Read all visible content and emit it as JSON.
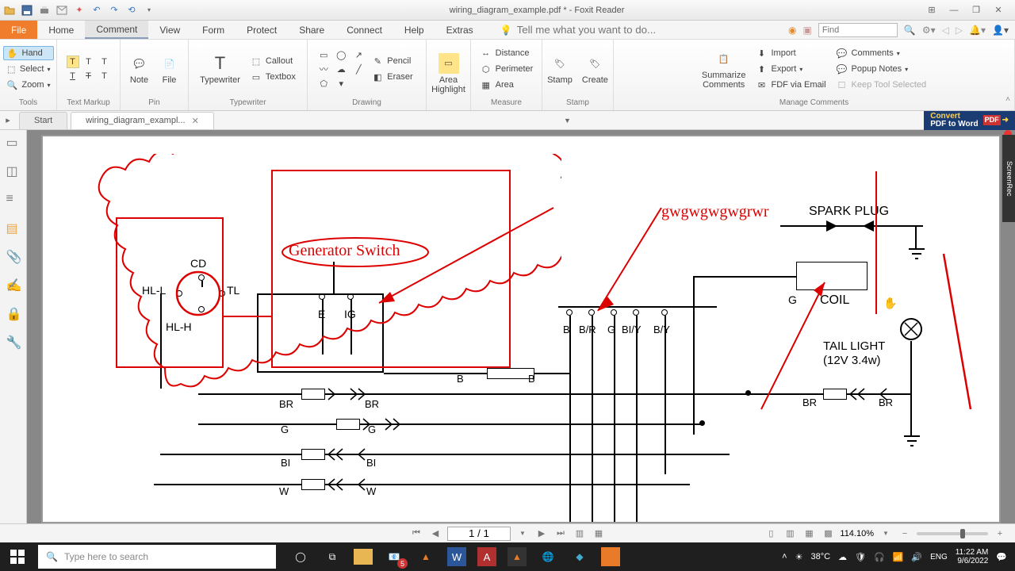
{
  "titlebar": {
    "title": "wiring_diagram_example.pdf * - Foxit Reader"
  },
  "menu": {
    "file": "File",
    "items": [
      "Home",
      "Comment",
      "View",
      "Form",
      "Protect",
      "Share",
      "Connect",
      "Help",
      "Extras"
    ],
    "active_index": 1,
    "help_placeholder": "Tell me what you want to do...",
    "find_placeholder": "Find"
  },
  "ribbon": {
    "tools": {
      "hand": "Hand",
      "select": "Select",
      "zoom": "Zoom",
      "label": "Tools"
    },
    "textmarkup": {
      "label": "Text Markup"
    },
    "pin": {
      "note": "Note",
      "file": "File",
      "label": "Pin"
    },
    "typewriter": {
      "typewriter": "Typewriter",
      "callout": "Callout",
      "textbox": "Textbox",
      "label": "Typewriter"
    },
    "drawing": {
      "pencil": "Pencil",
      "eraser": "Eraser",
      "label": "Drawing"
    },
    "area": {
      "area": "Area\nHighlight"
    },
    "measure": {
      "distance": "Distance",
      "perimeter": "Perimeter",
      "area": "Area",
      "label": "Measure"
    },
    "stamp": {
      "stamp": "Stamp",
      "create": "Create",
      "label": "Stamp"
    },
    "manage": {
      "summarize": "Summarize\nComments",
      "import": "Import",
      "export": "Export",
      "fdf": "FDF via Email",
      "comments": "Comments",
      "popup": "Popup Notes",
      "keep": "Keep Tool Selected",
      "label": "Manage Comments"
    }
  },
  "tabs": {
    "start": "Start",
    "doc": "wiring_diagram_exampl...",
    "convert1": "Convert",
    "convert2": "PDF to Word"
  },
  "diagram": {
    "spark_plug": "SPARK PLUG",
    "coil": "COIL",
    "tail_light": "TAIL LIGHT",
    "tail_spec": "(12V 3.4w)",
    "cd": "CD",
    "hll": "HL-L",
    "hlh": "HL-H",
    "tl": "TL",
    "e": "E",
    "ig": "IG",
    "b": "B",
    "br_label1": "B/R",
    "g_label": "G",
    "biy": "BI/Y",
    "by": "B/Y",
    "b_single": "B",
    "br": "BR",
    "g": "G",
    "bi": "BI",
    "w": "W"
  },
  "annotations": {
    "gen_switch": "Generator Switch",
    "gw": "gwgwgwgwgrwr"
  },
  "nav": {
    "page": "1 / 1",
    "zoom": "114.10%"
  },
  "taskbar": {
    "search": "Type here to search",
    "weather": "38°C",
    "time": "11:22 AM",
    "date": "9/6/2022",
    "badge5": "5"
  },
  "screenrec": "ScreenRec"
}
